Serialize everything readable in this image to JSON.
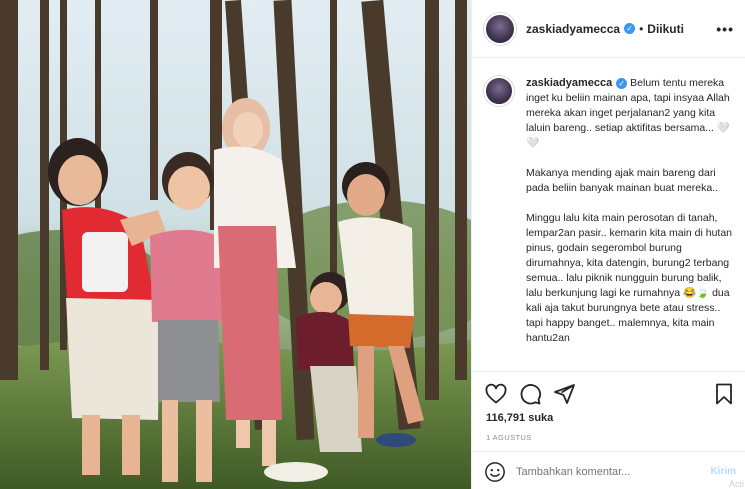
{
  "post": {
    "username": "zaskiadyamecca",
    "follow_status": "Diikuti",
    "separator": "•",
    "caption_paragraphs": [
      "Belum tentu mereka inget ku beliin mainan apa, tapi insyaa Allah mereka akan inget perjalanan2 yang kita laluin bareng.. setiap aktifitas bersama... 🤍🤍",
      "Makanya mending ajak main bareng dari pada beliin banyak mainan buat mereka..",
      "Minggu lalu kita main perosotan di tanah, lempar2an pasir.. kemarin kita main di hutan pinus, godain segerombol burung dirumahnya, kita datengin, burung2 terbang semua.. lalu piknik nungguin burung balik, lalu berkunjung lagi ke rumahnya 😂🍃 dua kali aja takut burungnya bete atau stress.. tapi happy banget.. malemnya, kita main hantu2an"
    ],
    "likes": "116,791 suka",
    "date": "1 AGUSTUS",
    "comment_placeholder": "Tambahkan komentar...",
    "post_button": "Kirim",
    "watermark": "Acti"
  },
  "icons": {
    "verified": "verified-badge-icon",
    "more": "more-options-icon",
    "like": "heart-icon",
    "comment": "comment-icon",
    "share": "share-icon",
    "save": "bookmark-icon",
    "emoji": "emoji-icon"
  },
  "colors": {
    "verified": "#3897f0",
    "muted": "#8e8e8e",
    "post_button": "#b3dbff"
  }
}
